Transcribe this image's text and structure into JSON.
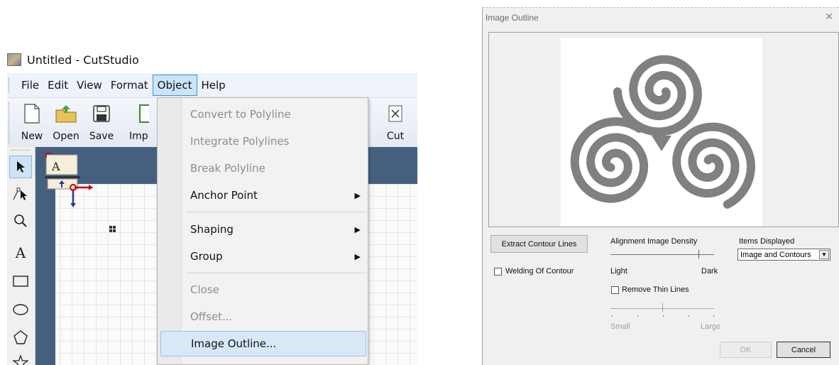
{
  "app": {
    "title": "Untitled - CutStudio",
    "menu": [
      "File",
      "Edit",
      "View",
      "Format",
      "Object",
      "Help"
    ],
    "active_menu": "Object",
    "toolbar": [
      {
        "label": "New",
        "icon": "new-document-icon"
      },
      {
        "label": "Open",
        "icon": "open-folder-icon"
      },
      {
        "label": "Save",
        "icon": "save-disk-icon"
      },
      {
        "label": "Imp",
        "icon": "import-icon"
      },
      {
        "label": "Cut",
        "icon": "cut-icon"
      }
    ],
    "tools": [
      "select-arrow-icon",
      "node-edit-icon",
      "zoom-icon",
      "text-tool-icon",
      "rectangle-tool-icon",
      "ellipse-tool-icon",
      "polygon-tool-icon",
      "star-tool-icon"
    ],
    "text_tool_glyph": "A",
    "object_glyph": "A"
  },
  "object_menu": {
    "items": [
      {
        "label": "Convert to Polyline",
        "disabled": true
      },
      {
        "label": "Integrate Polylines",
        "disabled": true
      },
      {
        "label": "Break Polyline",
        "disabled": true
      },
      {
        "label": "Anchor Point",
        "submenu": true
      },
      {
        "label": "Shaping",
        "submenu": true
      },
      {
        "label": "Group",
        "submenu": true
      },
      {
        "label": "Close",
        "disabled": true
      },
      {
        "label": "Offset...",
        "disabled": true
      },
      {
        "label": "Image Outline...",
        "highlighted": true
      }
    ]
  },
  "dialog": {
    "title": "Image Outline",
    "close": "✕",
    "extract_button": "Extract Contour Lines",
    "welding_label": "Welding Of Contour",
    "density_label": "Alignment Image Density",
    "density_left": "Light",
    "density_right": "Dark",
    "density_value": 0.85,
    "remove_thin_label": "Remove Thin Lines",
    "thin_left": "Small",
    "thin_right": "Large",
    "thin_value": 0.5,
    "items_label": "Items Displayed",
    "items_value": "Image and Contours",
    "ok": "OK",
    "cancel": "Cancel"
  },
  "colors": {
    "workarea": "#45607f",
    "menu_highlight": "#cce4f7",
    "spiral": "#808080"
  }
}
